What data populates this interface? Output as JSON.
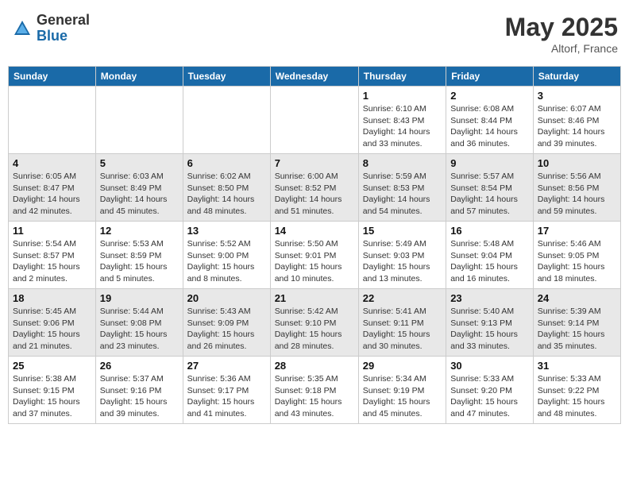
{
  "header": {
    "logo_general": "General",
    "logo_blue": "Blue",
    "month_year": "May 2025",
    "location": "Altorf, France"
  },
  "days_of_week": [
    "Sunday",
    "Monday",
    "Tuesday",
    "Wednesday",
    "Thursday",
    "Friday",
    "Saturday"
  ],
  "weeks": [
    [
      {
        "day": "",
        "info": ""
      },
      {
        "day": "",
        "info": ""
      },
      {
        "day": "",
        "info": ""
      },
      {
        "day": "",
        "info": ""
      },
      {
        "day": "1",
        "info": "Sunrise: 6:10 AM\nSunset: 8:43 PM\nDaylight: 14 hours\nand 33 minutes."
      },
      {
        "day": "2",
        "info": "Sunrise: 6:08 AM\nSunset: 8:44 PM\nDaylight: 14 hours\nand 36 minutes."
      },
      {
        "day": "3",
        "info": "Sunrise: 6:07 AM\nSunset: 8:46 PM\nDaylight: 14 hours\nand 39 minutes."
      }
    ],
    [
      {
        "day": "4",
        "info": "Sunrise: 6:05 AM\nSunset: 8:47 PM\nDaylight: 14 hours\nand 42 minutes."
      },
      {
        "day": "5",
        "info": "Sunrise: 6:03 AM\nSunset: 8:49 PM\nDaylight: 14 hours\nand 45 minutes."
      },
      {
        "day": "6",
        "info": "Sunrise: 6:02 AM\nSunset: 8:50 PM\nDaylight: 14 hours\nand 48 minutes."
      },
      {
        "day": "7",
        "info": "Sunrise: 6:00 AM\nSunset: 8:52 PM\nDaylight: 14 hours\nand 51 minutes."
      },
      {
        "day": "8",
        "info": "Sunrise: 5:59 AM\nSunset: 8:53 PM\nDaylight: 14 hours\nand 54 minutes."
      },
      {
        "day": "9",
        "info": "Sunrise: 5:57 AM\nSunset: 8:54 PM\nDaylight: 14 hours\nand 57 minutes."
      },
      {
        "day": "10",
        "info": "Sunrise: 5:56 AM\nSunset: 8:56 PM\nDaylight: 14 hours\nand 59 minutes."
      }
    ],
    [
      {
        "day": "11",
        "info": "Sunrise: 5:54 AM\nSunset: 8:57 PM\nDaylight: 15 hours\nand 2 minutes."
      },
      {
        "day": "12",
        "info": "Sunrise: 5:53 AM\nSunset: 8:59 PM\nDaylight: 15 hours\nand 5 minutes."
      },
      {
        "day": "13",
        "info": "Sunrise: 5:52 AM\nSunset: 9:00 PM\nDaylight: 15 hours\nand 8 minutes."
      },
      {
        "day": "14",
        "info": "Sunrise: 5:50 AM\nSunset: 9:01 PM\nDaylight: 15 hours\nand 10 minutes."
      },
      {
        "day": "15",
        "info": "Sunrise: 5:49 AM\nSunset: 9:03 PM\nDaylight: 15 hours\nand 13 minutes."
      },
      {
        "day": "16",
        "info": "Sunrise: 5:48 AM\nSunset: 9:04 PM\nDaylight: 15 hours\nand 16 minutes."
      },
      {
        "day": "17",
        "info": "Sunrise: 5:46 AM\nSunset: 9:05 PM\nDaylight: 15 hours\nand 18 minutes."
      }
    ],
    [
      {
        "day": "18",
        "info": "Sunrise: 5:45 AM\nSunset: 9:06 PM\nDaylight: 15 hours\nand 21 minutes."
      },
      {
        "day": "19",
        "info": "Sunrise: 5:44 AM\nSunset: 9:08 PM\nDaylight: 15 hours\nand 23 minutes."
      },
      {
        "day": "20",
        "info": "Sunrise: 5:43 AM\nSunset: 9:09 PM\nDaylight: 15 hours\nand 26 minutes."
      },
      {
        "day": "21",
        "info": "Sunrise: 5:42 AM\nSunset: 9:10 PM\nDaylight: 15 hours\nand 28 minutes."
      },
      {
        "day": "22",
        "info": "Sunrise: 5:41 AM\nSunset: 9:11 PM\nDaylight: 15 hours\nand 30 minutes."
      },
      {
        "day": "23",
        "info": "Sunrise: 5:40 AM\nSunset: 9:13 PM\nDaylight: 15 hours\nand 33 minutes."
      },
      {
        "day": "24",
        "info": "Sunrise: 5:39 AM\nSunset: 9:14 PM\nDaylight: 15 hours\nand 35 minutes."
      }
    ],
    [
      {
        "day": "25",
        "info": "Sunrise: 5:38 AM\nSunset: 9:15 PM\nDaylight: 15 hours\nand 37 minutes."
      },
      {
        "day": "26",
        "info": "Sunrise: 5:37 AM\nSunset: 9:16 PM\nDaylight: 15 hours\nand 39 minutes."
      },
      {
        "day": "27",
        "info": "Sunrise: 5:36 AM\nSunset: 9:17 PM\nDaylight: 15 hours\nand 41 minutes."
      },
      {
        "day": "28",
        "info": "Sunrise: 5:35 AM\nSunset: 9:18 PM\nDaylight: 15 hours\nand 43 minutes."
      },
      {
        "day": "29",
        "info": "Sunrise: 5:34 AM\nSunset: 9:19 PM\nDaylight: 15 hours\nand 45 minutes."
      },
      {
        "day": "30",
        "info": "Sunrise: 5:33 AM\nSunset: 9:20 PM\nDaylight: 15 hours\nand 47 minutes."
      },
      {
        "day": "31",
        "info": "Sunrise: 5:33 AM\nSunset: 9:22 PM\nDaylight: 15 hours\nand 48 minutes."
      }
    ]
  ]
}
